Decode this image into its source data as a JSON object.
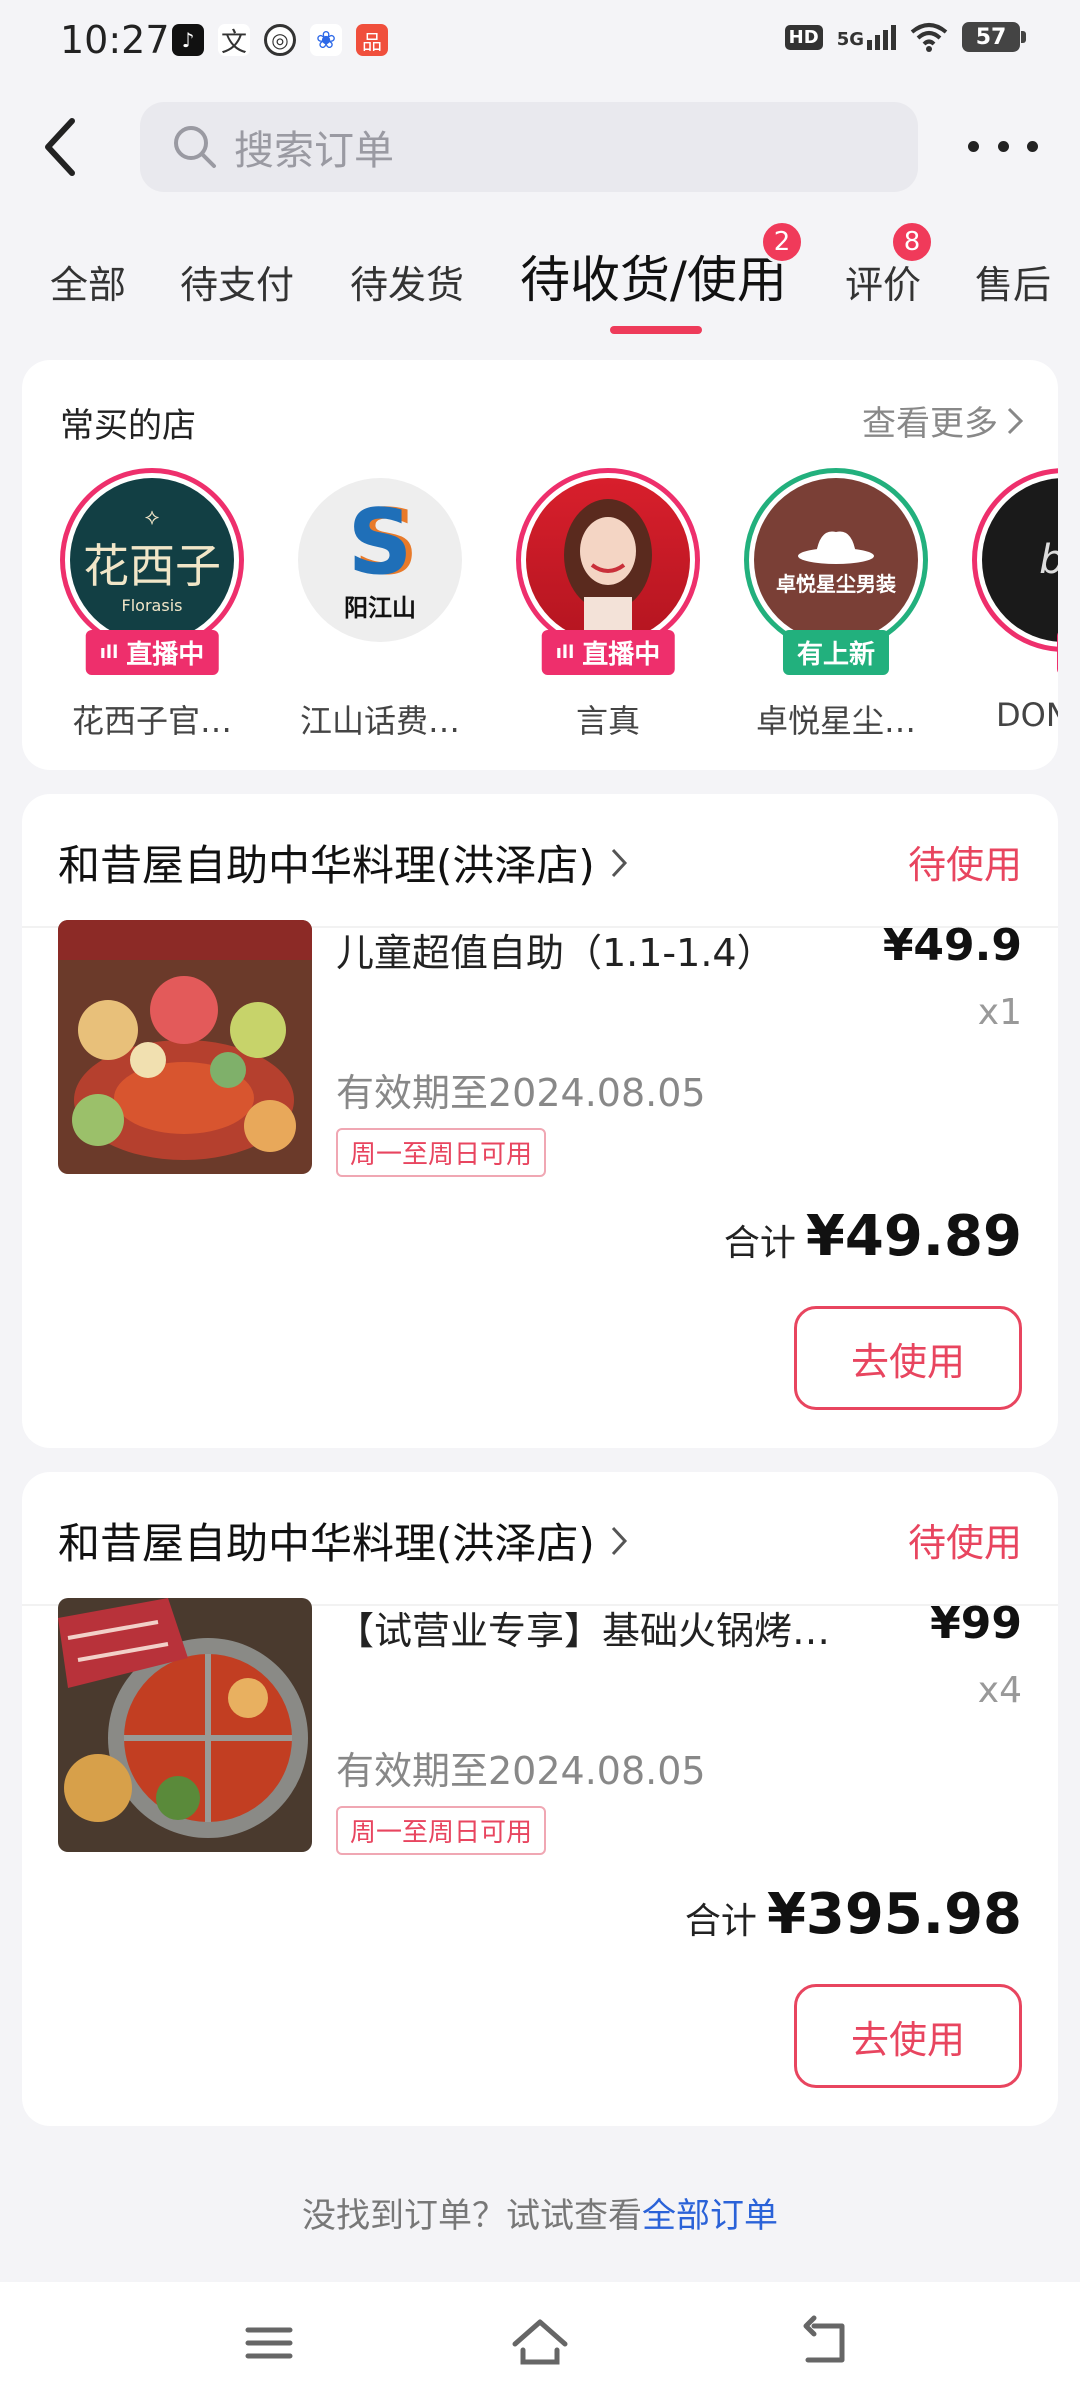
{
  "status_bar": {
    "time": "10:27",
    "network": "5G",
    "hd": "HD",
    "battery": "57"
  },
  "header": {
    "search_placeholder": "搜索订单"
  },
  "tabs": [
    {
      "label": "全部"
    },
    {
      "label": "待支付"
    },
    {
      "label": "待发货"
    },
    {
      "label": "待收货/使用",
      "badge": "2",
      "active": true
    },
    {
      "label": "评价",
      "badge": "8"
    },
    {
      "label": "售后"
    }
  ],
  "frequent_shops": {
    "title": "常买的店",
    "more_label": "查看更多",
    "shops": [
      {
        "name": "花西子官…",
        "tag": "直播中",
        "logo_text": "花西子",
        "logo_sub": "Florasis"
      },
      {
        "name": "江山话费…",
        "tag": "",
        "logo_text": "S",
        "logo_sub": "阳江山"
      },
      {
        "name": "言真",
        "tag": "直播中"
      },
      {
        "name": "卓悦星尘…",
        "tag": "有上新",
        "logo_text": "卓悦星尘男装"
      },
      {
        "name": "DONG",
        "tag": "有",
        "logo_text": "bo"
      }
    ]
  },
  "orders": [
    {
      "store": "和昔屋自助中华料理(洪泽店)",
      "status": "待使用",
      "product": "儿童超值自助（1.1-1.4）",
      "price": "¥49.9",
      "qty": "x1",
      "valid": "有效期至2024.08.05",
      "availability": "周一至周日可用",
      "total_label": "合计",
      "total": "¥49.89",
      "action": "去使用"
    },
    {
      "store": "和昔屋自助中华料理(洪泽店)",
      "status": "待使用",
      "product": "【试营业专享】基础火锅烤…",
      "price": "¥99",
      "qty": "x4",
      "valid": "有效期至2024.08.05",
      "availability": "周一至周日可用",
      "total_label": "合计",
      "total": "¥395.98",
      "action": "去使用"
    }
  ],
  "footer": {
    "hint": "没找到订单？试试查看",
    "link": "全部订单"
  },
  "colors": {
    "accent": "#e8455f",
    "live_tag": "#ee2f6c",
    "new_tag": "#22b07d",
    "link": "#2a62d8"
  },
  "icons": [
    "search-icon",
    "back-arrow-icon",
    "more-dots-icon",
    "chevron-right-icon",
    "menu-icon",
    "home-icon",
    "back-nav-icon"
  ]
}
